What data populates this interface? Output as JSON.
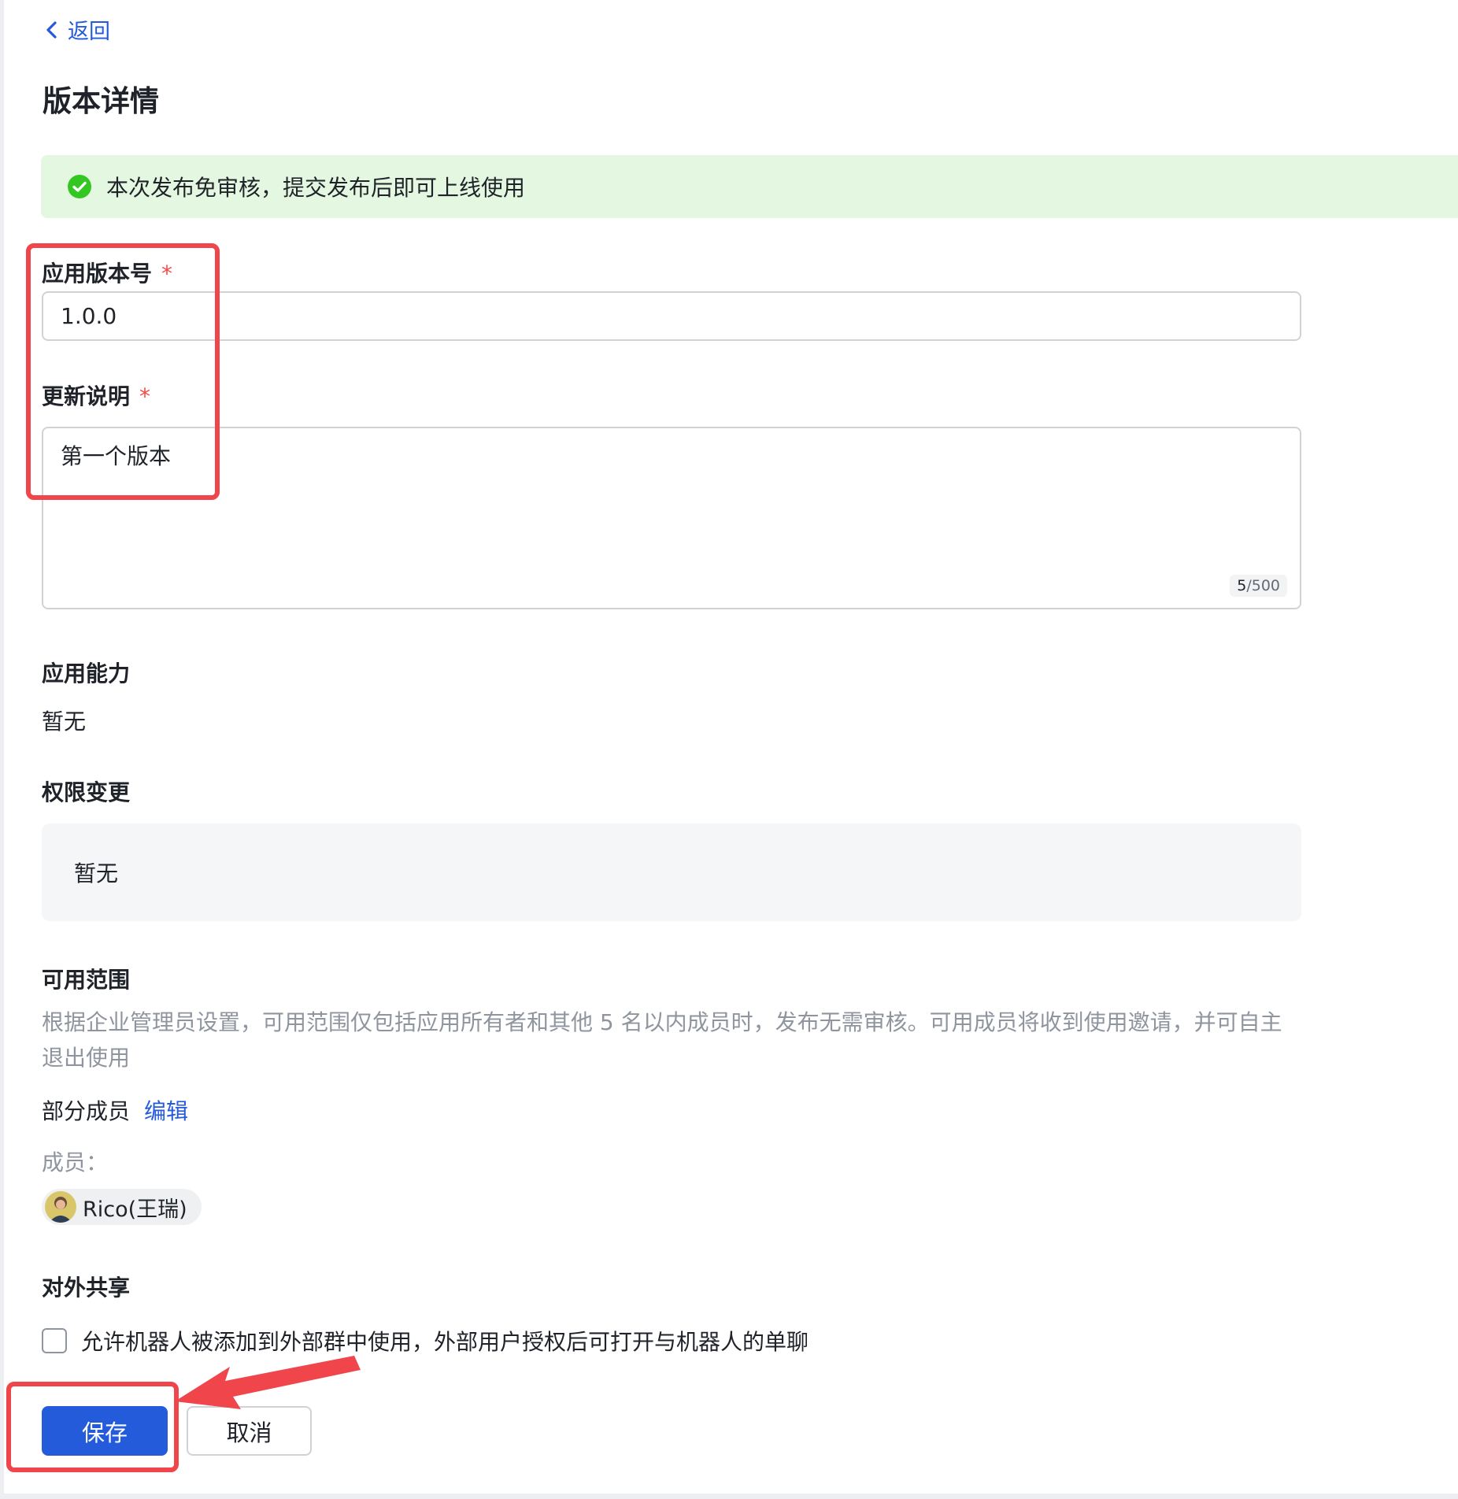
{
  "header": {
    "back_label": "返回",
    "title": "版本详情"
  },
  "notice": {
    "text": "本次发布免审核，提交发布后即可上线使用",
    "color": "#e4f8e1"
  },
  "form": {
    "version_label": "应用版本号",
    "version_value": "1.0.0",
    "notes_label": "更新说明",
    "notes_value": "第一个版本",
    "notes_count": "5",
    "notes_max": "/500",
    "required_mark": "*"
  },
  "capability": {
    "title": "应用能力",
    "value": "暂无"
  },
  "permissions": {
    "title": "权限变更",
    "value": "暂无"
  },
  "scope": {
    "title": "可用范围",
    "desc_line1": "根据企业管理员设置，可用范围仅包括应用所有者和其他 5 名以内成员时，发布无需审核。可用成员将收到使用邀请，并可自主",
    "desc_line2": "退出使用",
    "mode": "部分成员",
    "edit_label": "编辑",
    "members_label": "成员：",
    "members": [
      {
        "name": "Rico(王瑞)"
      }
    ]
  },
  "sharing": {
    "title": "对外共享",
    "checkbox_label": "允许机器人被添加到外部群中使用，外部用户授权后可打开与机器人的单聊",
    "checked": false
  },
  "actions": {
    "save_label": "保存",
    "cancel_label": "取消"
  },
  "colors": {
    "accent": "#245bdb",
    "required": "#f54a45",
    "annotation": "#f0454b",
    "success": "#34c724"
  }
}
